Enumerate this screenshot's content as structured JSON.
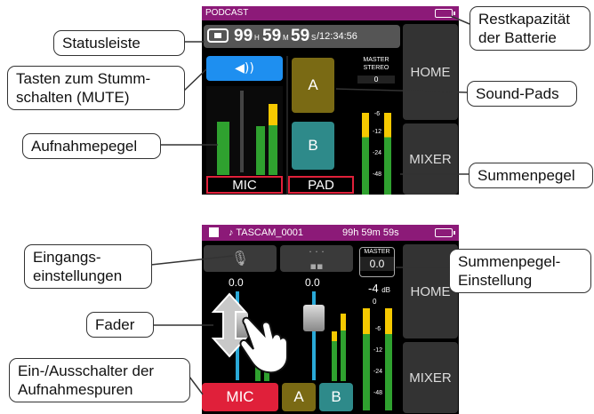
{
  "callouts": {
    "statusbar": "Statusleiste",
    "mute_line1": "Tasten zum Stumm-",
    "mute_line2": "schalten (MUTE)",
    "rec_level": "Aufnahmepegel",
    "battery_line1": "Restkapazität",
    "battery_line2": "der Batterie",
    "sound_pads": "Sound-Pads",
    "master_level": "Summenpegel",
    "input_settings_line1": "Eingangs-",
    "input_settings_line2": "einstellungen",
    "fader": "Fader",
    "track_switch_line1": "Ein-/Ausschalter der",
    "track_switch_line2": "Aufnahmespuren",
    "master_setting_line1": "Summenpegel-",
    "master_setting_line2": "Einstellung"
  },
  "screen1": {
    "title": "PODCAST",
    "time_h": "99",
    "unit_h": "H",
    "time_m": "59",
    "unit_m": "M",
    "time_s": "59",
    "unit_s": "S",
    "remaining": "/12:34:56",
    "master_label_line1": "MASTER",
    "master_label_line2": "STEREO",
    "master_zero": "0",
    "pad_a": "A",
    "pad_b": "B",
    "mic_label": "MIC",
    "pad_label": "PAD",
    "home": "HOME",
    "mixer": "MIXER",
    "scale": [
      "-6",
      "-12",
      "-24",
      "-48"
    ]
  },
  "screen2": {
    "file": "♪ TASCAM_0001",
    "remain": "99h 59m 59s",
    "master_label": "MASTER",
    "master_value": "0.0",
    "master_db": "-4",
    "master_db_unit": "dB",
    "fader1_value": "0.0",
    "fader2_value": "0.0",
    "mic": "MIC",
    "a": "A",
    "b": "B",
    "home": "HOME",
    "mixer": "MIXER",
    "master_zero": "0",
    "scale": [
      "-6",
      "-12",
      "-24",
      "-48"
    ]
  },
  "colors": {
    "statusbar": "#8c1a78",
    "mute_blue": "#1e8ff0",
    "pad_a": "#7a6a14",
    "pad_b": "#2e8a8a",
    "rec_red": "#e0203a"
  }
}
